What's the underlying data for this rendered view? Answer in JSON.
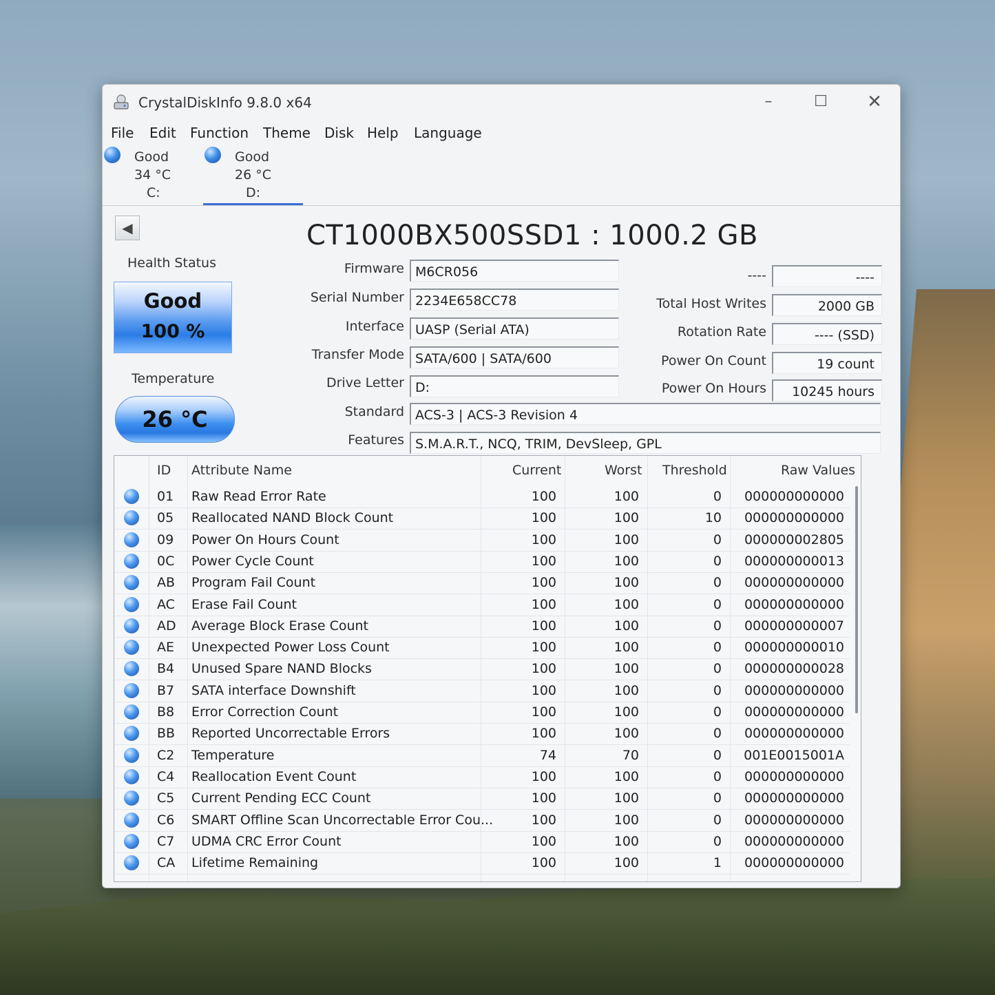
{
  "window": {
    "title": "CrystalDiskInfo 9.8.0 x64",
    "minimize": "–",
    "maximize": "☐",
    "close": "✕"
  },
  "menu": [
    "File",
    "Edit",
    "Function",
    "Theme",
    "Disk",
    "Help",
    "Language"
  ],
  "drives": [
    {
      "status": "Good",
      "temp": "34 °C",
      "letter": "C:"
    },
    {
      "status": "Good",
      "temp": "26 °C",
      "letter": "D:"
    }
  ],
  "model": "CT1000BX500SSD1 : 1000.2 GB",
  "health": {
    "label": "Health Status",
    "status": "Good",
    "percent": "100 %"
  },
  "temperature": {
    "label": "Temperature",
    "value": "26 °C"
  },
  "info": {
    "firmware_label": "Firmware",
    "firmware": "M6CR056",
    "serial_label": "Serial Number",
    "serial": "2234E658CC78",
    "interface_label": "Interface",
    "interface": "UASP (Serial ATA)",
    "transfer_label": "Transfer Mode",
    "transfer": "SATA/600 | SATA/600",
    "drive_letter_label": "Drive Letter",
    "drive_letter": "D:",
    "standard_label": "Standard",
    "standard": "ACS-3 | ACS-3 Revision 4",
    "features_label": "Features",
    "features": "S.M.A.R.T., NCQ, TRIM, DevSleep, GPL",
    "blank_label": "----",
    "blank_value": "----",
    "host_writes_label": "Total Host Writes",
    "host_writes": "2000 GB",
    "rotation_label": "Rotation Rate",
    "rotation": "---- (SSD)",
    "power_count_label": "Power On Count",
    "power_count": "19 count",
    "power_hours_label": "Power On Hours",
    "power_hours": "10245 hours"
  },
  "smart": {
    "headers": {
      "id": "ID",
      "name": "Attribute Name",
      "current": "Current",
      "worst": "Worst",
      "threshold": "Threshold",
      "raw": "Raw Values"
    },
    "rows": [
      {
        "id": "01",
        "name": "Raw Read Error Rate",
        "current": "100",
        "worst": "100",
        "threshold": "0",
        "raw": "000000000000"
      },
      {
        "id": "05",
        "name": "Reallocated NAND Block Count",
        "current": "100",
        "worst": "100",
        "threshold": "10",
        "raw": "000000000000"
      },
      {
        "id": "09",
        "name": "Power On Hours Count",
        "current": "100",
        "worst": "100",
        "threshold": "0",
        "raw": "000000002805"
      },
      {
        "id": "0C",
        "name": "Power Cycle Count",
        "current": "100",
        "worst": "100",
        "threshold": "0",
        "raw": "000000000013"
      },
      {
        "id": "AB",
        "name": "Program Fail Count",
        "current": "100",
        "worst": "100",
        "threshold": "0",
        "raw": "000000000000"
      },
      {
        "id": "AC",
        "name": "Erase Fail Count",
        "current": "100",
        "worst": "100",
        "threshold": "0",
        "raw": "000000000000"
      },
      {
        "id": "AD",
        "name": "Average Block Erase Count",
        "current": "100",
        "worst": "100",
        "threshold": "0",
        "raw": "000000000007"
      },
      {
        "id": "AE",
        "name": "Unexpected Power Loss Count",
        "current": "100",
        "worst": "100",
        "threshold": "0",
        "raw": "000000000010"
      },
      {
        "id": "B4",
        "name": "Unused Spare NAND Blocks",
        "current": "100",
        "worst": "100",
        "threshold": "0",
        "raw": "000000000028"
      },
      {
        "id": "B7",
        "name": "SATA interface Downshift",
        "current": "100",
        "worst": "100",
        "threshold": "0",
        "raw": "000000000000"
      },
      {
        "id": "B8",
        "name": "Error Correction Count",
        "current": "100",
        "worst": "100",
        "threshold": "0",
        "raw": "000000000000"
      },
      {
        "id": "BB",
        "name": "Reported Uncorrectable Errors",
        "current": "100",
        "worst": "100",
        "threshold": "0",
        "raw": "000000000000"
      },
      {
        "id": "C2",
        "name": "Temperature",
        "current": "74",
        "worst": "70",
        "threshold": "0",
        "raw": "001E0015001A"
      },
      {
        "id": "C4",
        "name": "Reallocation Event Count",
        "current": "100",
        "worst": "100",
        "threshold": "0",
        "raw": "000000000000"
      },
      {
        "id": "C5",
        "name": "Current Pending ECC Count",
        "current": "100",
        "worst": "100",
        "threshold": "0",
        "raw": "000000000000"
      },
      {
        "id": "C6",
        "name": "SMART Offline Scan Uncorrectable Error Cou...",
        "current": "100",
        "worst": "100",
        "threshold": "0",
        "raw": "000000000000"
      },
      {
        "id": "C7",
        "name": "UDMA CRC Error Count",
        "current": "100",
        "worst": "100",
        "threshold": "0",
        "raw": "000000000000"
      },
      {
        "id": "CA",
        "name": "Lifetime Remaining",
        "current": "100",
        "worst": "100",
        "threshold": "1",
        "raw": "000000000000"
      }
    ]
  }
}
